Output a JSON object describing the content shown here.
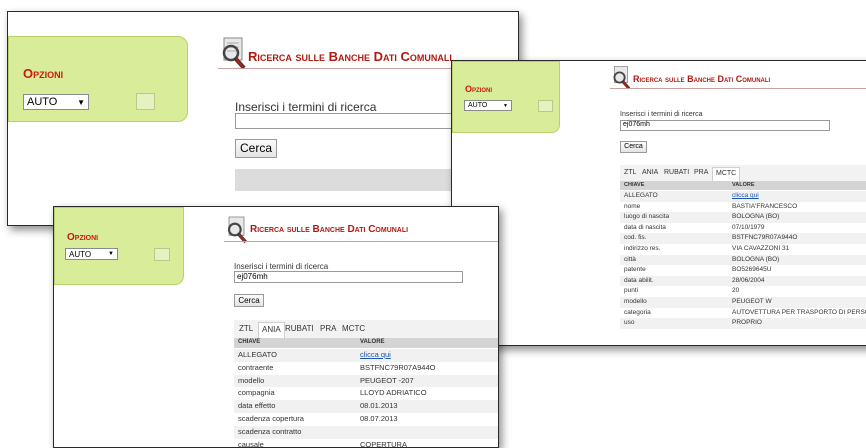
{
  "app": {
    "options_title": "Opzioni",
    "options_selected": "AUTO",
    "header_title": "Ricerca sulle Banche Dati Comunali",
    "search_label": "Inserisci i termini di ricerca",
    "search_button": "Cerca",
    "col_key": "CHIAVE",
    "col_value": "VALORE"
  },
  "win1": {
    "search_value": ""
  },
  "win2": {
    "search_value": "ej076mh",
    "tabs": [
      "ZTL",
      "ANIA",
      "RUBATI",
      "PRA",
      "MCTC"
    ],
    "active_tab": "MCTC",
    "rows": [
      {
        "k": "ALLEGATO",
        "v": "clicca qui",
        "link": true
      },
      {
        "k": "nome",
        "v": "BASTIA'FRANCESCO"
      },
      {
        "k": "luogo di nascita",
        "v": "BOLOGNA (BO)"
      },
      {
        "k": "data di nascita",
        "v": "07/10/1979"
      },
      {
        "k": "cod. fis.",
        "v": "BSTFNC79R07A944O"
      },
      {
        "k": "indirizzo res.",
        "v": "VIA CAVAZZONI 31"
      },
      {
        "k": "città",
        "v": "BOLOGNA (BO)"
      },
      {
        "k": "patente",
        "v": "BO5269645U"
      },
      {
        "k": "data abilit.",
        "v": "28/06/2004"
      },
      {
        "k": "punti",
        "v": "20"
      },
      {
        "k": "modello",
        "v": "PEUGEOT W"
      },
      {
        "k": "categoria",
        "v": "AUTOVETTURA PER TRASPORTO DI PERSONE"
      },
      {
        "k": "uso",
        "v": "PROPRIO"
      }
    ]
  },
  "win3": {
    "search_value": "ej076mh",
    "tabs": [
      "ZTL",
      "ANIA",
      "RUBATI",
      "PRA",
      "MCTC"
    ],
    "active_tab": "ANIA",
    "rows": [
      {
        "k": "ALLEGATO",
        "v": "clicca qui",
        "link": true
      },
      {
        "k": "contraente",
        "v": "BSTFNC79R07A944O"
      },
      {
        "k": "modello",
        "v": "PEUGEOT -207"
      },
      {
        "k": "compagnia",
        "v": "LLOYD ADRIATICO"
      },
      {
        "k": "data effetto",
        "v": "08.01.2013"
      },
      {
        "k": "scadenza copertura",
        "v": "08.07.2013"
      },
      {
        "k": "scadenza contratto",
        "v": ""
      },
      {
        "k": "causale",
        "v": "COPERTURA"
      }
    ]
  }
}
